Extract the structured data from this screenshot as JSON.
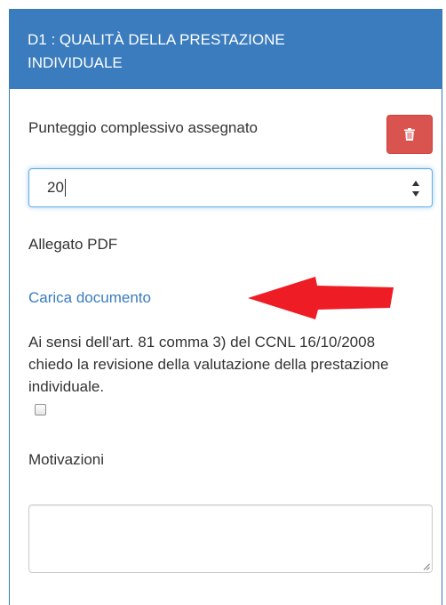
{
  "panel": {
    "title_line1": "D1 : QUALITÀ DELLA PRESTAZIONE",
    "title_line2": "INDIVIDUALE"
  },
  "score": {
    "label": "Punteggio complessivo assegnato",
    "value": "20"
  },
  "delete_button": {
    "icon": "trash-icon"
  },
  "attachment": {
    "label": "Allegato PDF",
    "upload_link": "Carica documento"
  },
  "revision": {
    "text": "Ai sensi dell'art. 81 comma 3) del CCNL 16/10/2008 chiedo la revisione della valutazione della prestazione individuale.",
    "checked": false
  },
  "motivations": {
    "label": "Motivazioni",
    "value": ""
  },
  "colors": {
    "header_bg": "#3a7cbd",
    "delete_bg": "#d9534f",
    "link": "#3a7cbd",
    "arrow": "#ee1c24"
  }
}
